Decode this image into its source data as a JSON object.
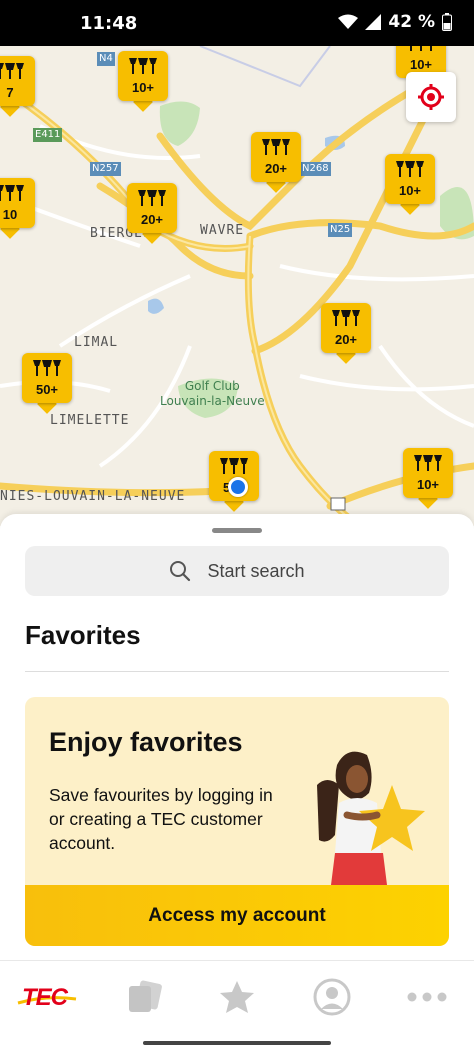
{
  "status_bar": {
    "time": "11:48",
    "battery": "42 %"
  },
  "map": {
    "labels": {
      "wavre": "WAVRE",
      "bierges": "BIERGES",
      "limal": "LIMAL",
      "limelette": "LIMELETTE",
      "louvain": "NIES-LOUVAIN-LA-NEUVE",
      "golf": "Golf Club\nLouvain-la-Neuve"
    },
    "road_signs": [
      "N4",
      "E411",
      "N257",
      "N268",
      "N25"
    ],
    "markers": [
      "7",
      "10+",
      "20+",
      "10+",
      "10",
      "20+",
      "20+",
      "50+",
      "50+",
      "10+",
      "10+"
    ]
  },
  "search": {
    "placeholder": "Start search"
  },
  "favorites": {
    "title": "Favorites",
    "card": {
      "heading": "Enjoy favorites",
      "body": "Save favourites by logging in or creating a TEC customer account.",
      "cta": "Access my account"
    }
  },
  "bottom_nav": {
    "logo_text": "TEC",
    "items": [
      "home-logo",
      "tickets-icon",
      "favorites-star-icon",
      "account-icon",
      "more-icon"
    ]
  },
  "colors": {
    "accent_yellow": "#f7be00",
    "brand_red": "#e2001a",
    "card_bg": "#fdf0c8"
  }
}
